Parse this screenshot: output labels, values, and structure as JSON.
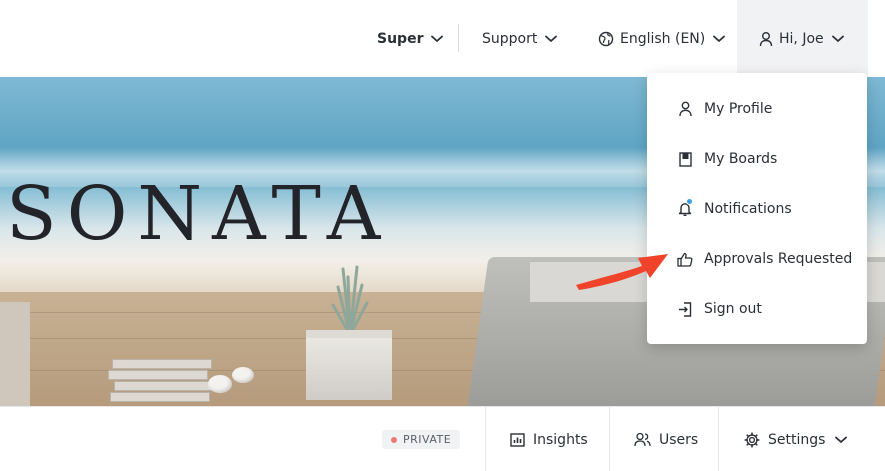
{
  "header": {
    "workspace": "Super",
    "support": "Support",
    "language": "English (EN)",
    "user_greeting": "Hi, Joe"
  },
  "hero": {
    "title": "SONATA"
  },
  "user_menu": {
    "items": [
      {
        "label": "My Profile",
        "icon": "person-icon"
      },
      {
        "label": "My Boards",
        "icon": "board-icon"
      },
      {
        "label": "Notifications",
        "icon": "bell-icon"
      },
      {
        "label": "Approvals Requested",
        "icon": "thumbs-up-icon"
      },
      {
        "label": "Sign out",
        "icon": "sign-out-icon"
      }
    ],
    "notification_dot_color": "#3aa3e8"
  },
  "bottom_bar": {
    "privacy": "PRIVATE",
    "privacy_dot_color": "#ea7b74",
    "insights": "Insights",
    "users": "Users",
    "settings": "Settings"
  },
  "annotation": {
    "arrow_color": "#f0432a"
  }
}
